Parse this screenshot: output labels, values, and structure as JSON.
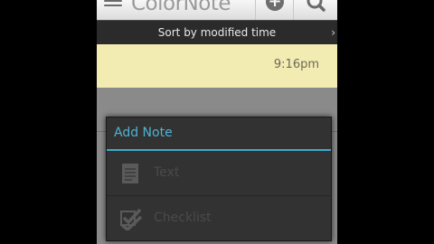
{
  "app_bar": {
    "title": "ColorNote",
    "add_button_icon": "plus-icon",
    "add_button_glyph": "+",
    "search_icon": "search-icon"
  },
  "sort_bar": {
    "label": "Sort by modified time",
    "arrow": "›"
  },
  "notes": [
    {
      "time": "9:16pm",
      "color": "#f2ebb2"
    }
  ],
  "dialog": {
    "title": "Add Note",
    "options": [
      {
        "label": "Text",
        "icon": "document-icon"
      },
      {
        "label": "Checklist",
        "icon": "checklist-icon"
      }
    ]
  },
  "colors": {
    "accent": "#42a7cc",
    "note_yellow": "#f2ebb2"
  }
}
